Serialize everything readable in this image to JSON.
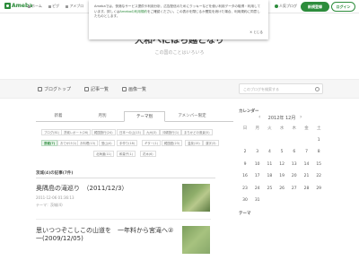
{
  "topbar": {
    "logo": "Ameba",
    "nav": [
      "ホーム",
      "ピグ",
      "アメブロ"
    ],
    "person_label": "人気ブログ",
    "register_label": "新規登録",
    "login_label": "ログイン"
  },
  "blog": {
    "title": "大和へにはち越となり",
    "subtitle": "この国のことはいろいろ"
  },
  "cookie": {
    "text_before": "Amebaでは、快適なサービス提供や利用分析、広告配信のためにクッキーなどを使い利用データの取得・利用しています。詳しくは",
    "link": "Amebaの利用規約",
    "text_after": "をご確認ください。この表示を閉じるか閲覧を続けた場合、利用規約に同意したものとします。",
    "close_label": "とじる"
  },
  "navbar": {
    "items": [
      "ブログトップ",
      "記事一覧",
      "画像一覧"
    ],
    "search_placeholder": "このブログを検索する"
  },
  "tabs": [
    "新着",
    "月別",
    "テーマ別",
    "アメンバー限定"
  ],
  "active_tab": 2,
  "theme_chips": [
    [
      "ブログ(81)",
      "茨城レポート(26)",
      "韓国旅行(24)",
      "日本一の山(13)",
      "九州(3)",
      "沖縄旅行(1)",
      "まちかどの風景(5)"
    ],
    [
      "茨城(7)",
      "おでかけ(1)",
      "お料理(13)",
      "登山(4)",
      "手作り(18)",
      "ギター(1)",
      "韓国語(23)",
      "温泉(15)",
      "漢字(3)"
    ],
    [
      "北海道(11)",
      "和菓子(1)",
      "花木(6)"
    ]
  ],
  "section_title": "茨城(4)の記事(7件)",
  "entries": [
    {
      "title": "奥隅島の滝巡り　（2011/12/3）",
      "date": "2011-12-06 01:36:13",
      "theme": "テーマ：茨城(4)"
    },
    {
      "title": "思いつつぞこしこの山道を　一年料から宮滝へ②一(2009/12/05)",
      "date": "",
      "theme": ""
    }
  ],
  "calendar": {
    "label": "カレンダー",
    "month": "2012年 12月",
    "dow": [
      "日",
      "月",
      "火",
      "水",
      "木",
      "金",
      "土"
    ],
    "weeks": [
      [
        "",
        "",
        "",
        "",
        "",
        "",
        "1"
      ],
      [
        "2",
        "3",
        "4",
        "5",
        "6",
        "7",
        "8"
      ],
      [
        "9",
        "10",
        "11",
        "12",
        "13",
        "14",
        "15"
      ],
      [
        "16",
        "17",
        "18",
        "19",
        "20",
        "21",
        "22"
      ],
      [
        "23",
        "24",
        "25",
        "26",
        "27",
        "28",
        "29"
      ],
      [
        "30",
        "31",
        "",
        "",
        "",
        "",
        ""
      ]
    ],
    "theme_label": "テーマ"
  },
  "colors": {
    "brand": "#2d8c3c"
  }
}
